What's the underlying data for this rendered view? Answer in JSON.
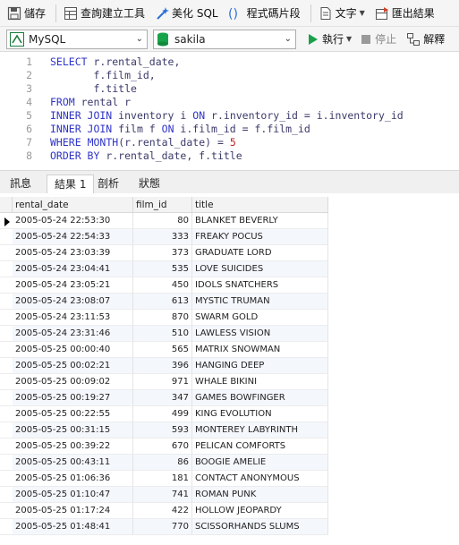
{
  "toolbar": {
    "save": "儲存",
    "query_builder": "查詢建立工具",
    "beautify_sql": "美化 SQL",
    "code_snippet": "程式碼片段",
    "text": "文字",
    "export_result": "匯出結果"
  },
  "connection_bar": {
    "connection": "MySQL",
    "database": "sakila",
    "run": "執行",
    "stop": "停止",
    "explain": "解釋"
  },
  "editor": {
    "line_numbers": [
      "1",
      "2",
      "3",
      "4",
      "5",
      "6",
      "7",
      "8"
    ]
  },
  "result_tabs": [
    "訊息",
    "結果 1",
    "剖析",
    "狀態"
  ],
  "columns": [
    "rental_date",
    "film_id",
    "title"
  ],
  "rows": [
    [
      "2005-05-24 22:53:30",
      "80",
      "BLANKET BEVERLY"
    ],
    [
      "2005-05-24 22:54:33",
      "333",
      "FREAKY POCUS"
    ],
    [
      "2005-05-24 23:03:39",
      "373",
      "GRADUATE LORD"
    ],
    [
      "2005-05-24 23:04:41",
      "535",
      "LOVE SUICIDES"
    ],
    [
      "2005-05-24 23:05:21",
      "450",
      "IDOLS SNATCHERS"
    ],
    [
      "2005-05-24 23:08:07",
      "613",
      "MYSTIC TRUMAN"
    ],
    [
      "2005-05-24 23:11:53",
      "870",
      "SWARM GOLD"
    ],
    [
      "2005-05-24 23:31:46",
      "510",
      "LAWLESS VISION"
    ],
    [
      "2005-05-25 00:00:40",
      "565",
      "MATRIX SNOWMAN"
    ],
    [
      "2005-05-25 00:02:21",
      "396",
      "HANGING DEEP"
    ],
    [
      "2005-05-25 00:09:02",
      "971",
      "WHALE BIKINI"
    ],
    [
      "2005-05-25 00:19:27",
      "347",
      "GAMES BOWFINGER"
    ],
    [
      "2005-05-25 00:22:55",
      "499",
      "KING EVOLUTION"
    ],
    [
      "2005-05-25 00:31:15",
      "593",
      "MONTEREY LABYRINTH"
    ],
    [
      "2005-05-25 00:39:22",
      "670",
      "PELICAN COMFORTS"
    ],
    [
      "2005-05-25 00:43:11",
      "86",
      "BOOGIE AMELIE"
    ],
    [
      "2005-05-25 01:06:36",
      "181",
      "CONTACT ANONYMOUS"
    ],
    [
      "2005-05-25 01:10:47",
      "741",
      "ROMAN PUNK"
    ],
    [
      "2005-05-25 01:17:24",
      "422",
      "HOLLOW JEOPARDY"
    ],
    [
      "2005-05-25 01:48:41",
      "770",
      "SCISSORHANDS SLUMS"
    ]
  ],
  "colors": {
    "keyword": "#2f35c8",
    "number": "#c02020",
    "run_icon": "#1aa04a",
    "db_icon": "#17a34a",
    "beautify_icon": "#2b6fd6"
  }
}
